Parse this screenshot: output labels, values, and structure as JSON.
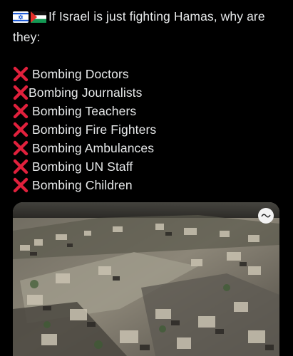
{
  "post": {
    "intro": "If Israel is just fighting Hamas, why are they:",
    "flags": [
      "israel-flag-icon",
      "palestine-flag-icon"
    ],
    "list_icon": "cross-mark-icon",
    "list": [
      "Bombing Doctors",
      "Bombing Journalists",
      "Bombing Teachers",
      "Bombing Fire Fighters",
      "Bombing Ambulances",
      "Bombing UN Staff",
      "Bombing Children"
    ]
  },
  "colors": {
    "background": "#000000",
    "text": "#e7e9ea",
    "cross": "#e0203c"
  }
}
